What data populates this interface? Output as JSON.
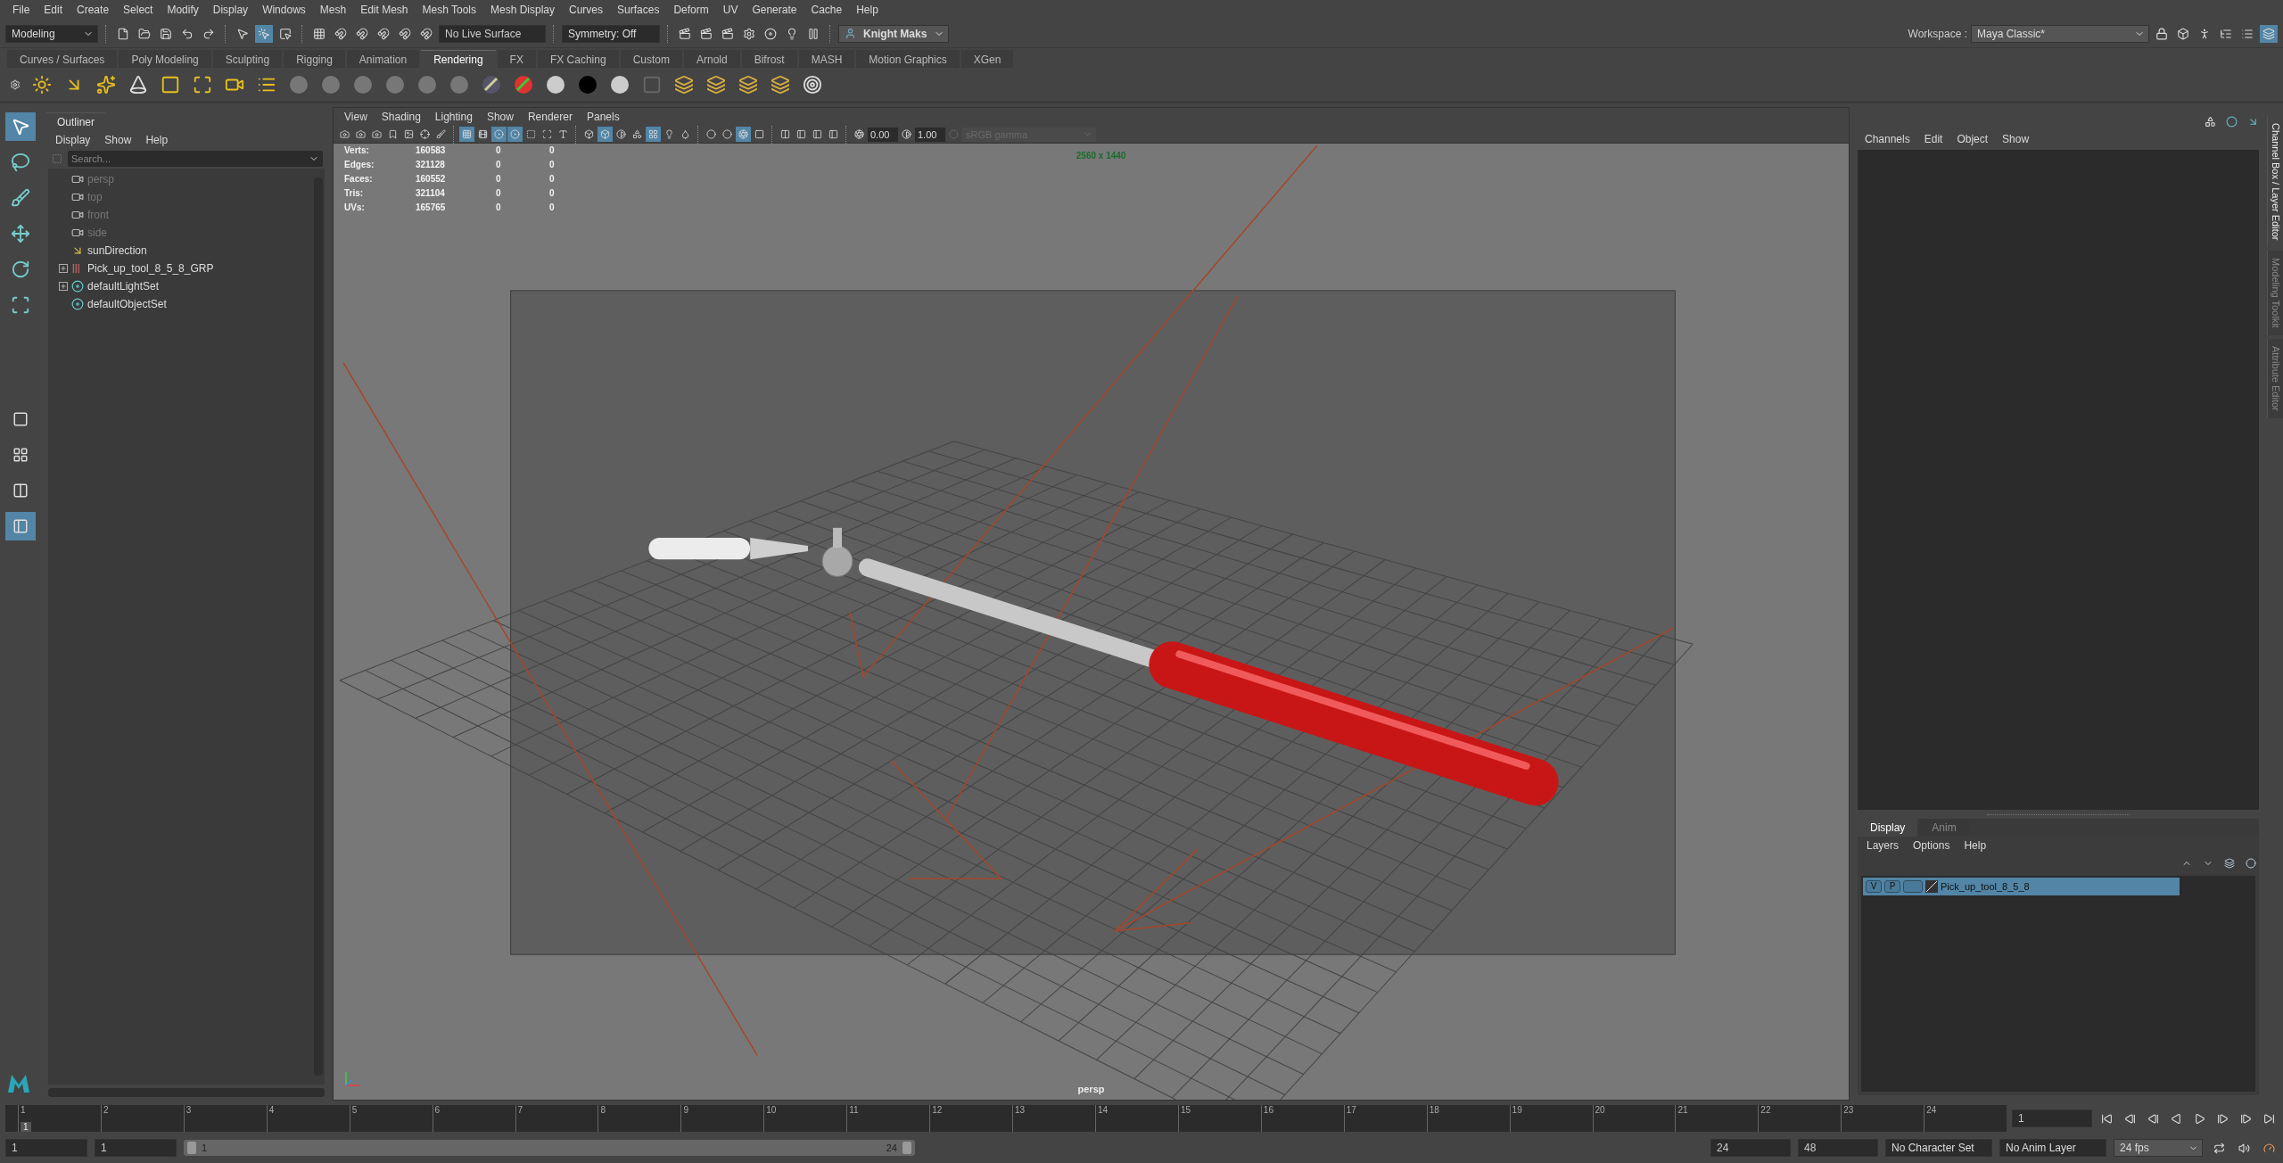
{
  "menu_bar": [
    "File",
    "Edit",
    "Create",
    "Select",
    "Modify",
    "Display",
    "Windows",
    "Mesh",
    "Edit Mesh",
    "Mesh Tools",
    "Mesh Display",
    "Curves",
    "Surfaces",
    "Deform",
    "UV",
    "Generate",
    "Cache",
    "Help"
  ],
  "status_line": {
    "mode": "Modeling",
    "live_surface": "No Live Surface",
    "symmetry": "Symmetry: Off",
    "user": "Knight Maks",
    "workspace_label": "Workspace :",
    "workspace": "Maya Classic*",
    "tools": [
      {
        "kind": "file",
        "on": false
      },
      {
        "kind": "folder",
        "on": false
      },
      {
        "kind": "save",
        "on": false
      },
      {
        "kind": "undo",
        "on": false
      },
      {
        "kind": "redo",
        "on": false
      },
      {
        "kind": "sep"
      },
      {
        "kind": "select-hierarchy",
        "on": false
      },
      {
        "kind": "select-object",
        "on": true
      },
      {
        "kind": "select-component",
        "on": false
      },
      {
        "kind": "sep"
      },
      {
        "kind": "snap-grid",
        "on": false
      },
      {
        "kind": "snap-curve",
        "on": false
      },
      {
        "kind": "snap-point",
        "on": false
      },
      {
        "kind": "snap-view",
        "on": false
      },
      {
        "kind": "snap-surface",
        "on": false
      },
      {
        "kind": "snap-live",
        "on": false
      }
    ],
    "render_tools": [
      {
        "kind": "render-view",
        "on": false
      },
      {
        "kind": "render",
        "on": false
      },
      {
        "kind": "ipr",
        "on": false
      },
      {
        "kind": "render-settings",
        "on": false
      },
      {
        "kind": "hypershade",
        "on": false
      },
      {
        "kind": "light-editor",
        "on": false
      },
      {
        "kind": "pause",
        "on": false
      }
    ],
    "panel_tools": [
      {
        "kind": "toolkit",
        "on": false
      },
      {
        "kind": "character",
        "on": false
      },
      {
        "kind": "attributes",
        "on": false
      },
      {
        "kind": "tool-settings",
        "on": false
      },
      {
        "kind": "channel-box",
        "on": true
      }
    ]
  },
  "shelf_tabs": [
    {
      "label": "Curves / Surfaces",
      "selected": false
    },
    {
      "label": "Poly Modeling",
      "selected": false
    },
    {
      "label": "Sculpting",
      "selected": false
    },
    {
      "label": "Rigging",
      "selected": false
    },
    {
      "label": "Animation",
      "selected": false
    },
    {
      "label": "Rendering",
      "selected": true
    },
    {
      "label": "FX",
      "selected": false
    },
    {
      "label": "FX Caching",
      "selected": false
    },
    {
      "label": "Custom",
      "selected": false
    },
    {
      "label": "Arnold",
      "selected": false
    },
    {
      "label": "Bifrost",
      "selected": false
    },
    {
      "label": "MASH",
      "selected": false
    },
    {
      "label": "Motion Graphics",
      "selected": false
    },
    {
      "label": "XGen",
      "selected": false
    }
  ],
  "shelf": [
    {
      "kind": "sun"
    },
    {
      "kind": "directional-light"
    },
    {
      "kind": "point-light"
    },
    {
      "kind": "spot-light"
    },
    {
      "kind": "area-light"
    },
    {
      "kind": "volume-light"
    },
    {
      "kind": "camera"
    },
    {
      "kind": "list"
    },
    {
      "kind": "sphere"
    },
    {
      "kind": "sphere"
    },
    {
      "kind": "sphere"
    },
    {
      "kind": "sphere"
    },
    {
      "kind": "sphere"
    },
    {
      "kind": "sphere"
    },
    {
      "kind": "striped-sphere"
    },
    {
      "kind": "ramp-sphere"
    },
    {
      "kind": "light-sphere"
    },
    {
      "kind": "dark-sphere"
    },
    {
      "kind": "light-sphere"
    },
    {
      "kind": "texture"
    },
    {
      "kind": "stack"
    },
    {
      "kind": "stack"
    },
    {
      "kind": "stack"
    },
    {
      "kind": "stack-selected"
    },
    {
      "kind": "brush"
    }
  ],
  "toolbox": [
    {
      "kind": "select",
      "selected": true
    },
    {
      "kind": "lasso",
      "selected": false
    },
    {
      "kind": "paint",
      "selected": false
    },
    {
      "kind": "move",
      "selected": false
    },
    {
      "kind": "rotate",
      "selected": false
    },
    {
      "kind": "scale",
      "selected": false
    }
  ],
  "layouts": [
    {
      "kind": "single",
      "selected": false
    },
    {
      "kind": "quad",
      "selected": false
    },
    {
      "kind": "two",
      "selected": false
    },
    {
      "kind": "outliner-persp",
      "selected": true
    }
  ],
  "outliner": {
    "title": "Outliner",
    "menus": [
      "Display",
      "Show",
      "Help"
    ],
    "search_placeholder": "Search...",
    "items": [
      {
        "label": "persp",
        "kind": "camera",
        "dimmed": true,
        "has_children": false
      },
      {
        "label": "top",
        "kind": "camera",
        "dimmed": true,
        "has_children": false
      },
      {
        "label": "front",
        "kind": "camera",
        "dimmed": true,
        "has_children": false
      },
      {
        "label": "side",
        "kind": "camera",
        "dimmed": true,
        "has_children": false
      },
      {
        "label": "sunDirection",
        "kind": "light",
        "dimmed": false,
        "has_children": false
      },
      {
        "label": "Pick_up_tool_8_5_8_GRP",
        "kind": "group",
        "dimmed": false,
        "has_children": true
      },
      {
        "label": "defaultLightSet",
        "kind": "set",
        "dimmed": false,
        "has_children": true
      },
      {
        "label": "defaultObjectSet",
        "kind": "set",
        "dimmed": false,
        "has_children": false
      }
    ]
  },
  "viewport": {
    "menus": [
      "View",
      "Shading",
      "Lighting",
      "Show",
      "Renderer",
      "Panels"
    ],
    "tools": [
      {
        "kind": "camera",
        "on": false
      },
      {
        "kind": "camera",
        "on": false
      },
      {
        "kind": "camera",
        "on": false
      },
      {
        "kind": "bookmark",
        "on": false
      },
      {
        "kind": "image-plane",
        "on": false
      },
      {
        "kind": "pivot",
        "on": false
      },
      {
        "kind": "brush",
        "on": false
      },
      {
        "kind": "sep"
      },
      {
        "kind": "grid",
        "on": true
      },
      {
        "kind": "film",
        "on": false
      },
      {
        "kind": "gate",
        "on": true
      },
      {
        "kind": "gate",
        "on": true
      },
      {
        "kind": "field",
        "on": false
      },
      {
        "kind": "safe",
        "on": false
      },
      {
        "kind": "text",
        "on": false
      },
      {
        "kind": "sep"
      },
      {
        "kind": "wireframe",
        "on": false
      },
      {
        "kind": "smooth",
        "on": true
      },
      {
        "kind": "half",
        "on": false
      },
      {
        "kind": "wire-on-shaded",
        "on": false
      },
      {
        "kind": "textured",
        "on": true
      },
      {
        "kind": "lights",
        "on": false
      },
      {
        "kind": "shadows",
        "on": false
      },
      {
        "kind": "sep"
      },
      {
        "kind": "ambient",
        "on": false
      },
      {
        "kind": "ambient",
        "on": false
      },
      {
        "kind": "aa",
        "on": true
      },
      {
        "kind": "dof",
        "on": false
      },
      {
        "kind": "sep"
      },
      {
        "kind": "isolate",
        "on": false
      },
      {
        "kind": "xray",
        "on": false
      },
      {
        "kind": "xray",
        "on": false
      },
      {
        "kind": "xray",
        "on": false
      }
    ],
    "exposure": "0.00",
    "gamma": "1.00",
    "color_space": "sRGB gamma",
    "hud": [
      {
        "label": "Verts:",
        "values": [
          "160583",
          "0",
          "0"
        ]
      },
      {
        "label": "Edges:",
        "values": [
          "321128",
          "0",
          "0"
        ]
      },
      {
        "label": "Faces:",
        "values": [
          "160552",
          "0",
          "0"
        ]
      },
      {
        "label": "Tris:",
        "values": [
          "321104",
          "0",
          "0"
        ]
      },
      {
        "label": "UVs:",
        "values": [
          "165765",
          "0",
          "0"
        ]
      }
    ],
    "resolution": "2560 x 1440",
    "camera": "persp"
  },
  "channel_box": {
    "menus": [
      "Channels",
      "Edit",
      "Object",
      "Show"
    ]
  },
  "side_tabs": [
    {
      "label": "Channel Box / Layer Editor",
      "selected": true
    },
    {
      "label": "Modeling Toolkit",
      "selected": false
    },
    {
      "label": "Attribute Editor",
      "selected": false
    }
  ],
  "layer_editor": {
    "tabs": [
      {
        "label": "Display",
        "selected": true
      },
      {
        "label": "Anim",
        "selected": false
      }
    ],
    "menus": [
      "Layers",
      "Options",
      "Help"
    ],
    "layers": [
      {
        "name": "Pick_up_tool_8_5_8",
        "visible": "V",
        "playback": "P",
        "selected": true
      }
    ]
  },
  "time_slider": {
    "ticks": [
      "1",
      "2",
      "3",
      "4",
      "5",
      "6",
      "7",
      "8",
      "9",
      "10",
      "11",
      "12",
      "13",
      "14",
      "15",
      "16",
      "17",
      "18",
      "19",
      "20",
      "21",
      "22",
      "23",
      "24"
    ],
    "current_frame": "1",
    "level": 0,
    "frame_field": "1"
  },
  "range_slider": {
    "start": "1",
    "playback_start": "1",
    "range_start": "1",
    "range_end": "24",
    "level": 1,
    "playback_end": "24",
    "end": "48",
    "character_set": "No Character Set",
    "anim_layer": "No Anim Layer",
    "fps": "24 fps"
  }
}
